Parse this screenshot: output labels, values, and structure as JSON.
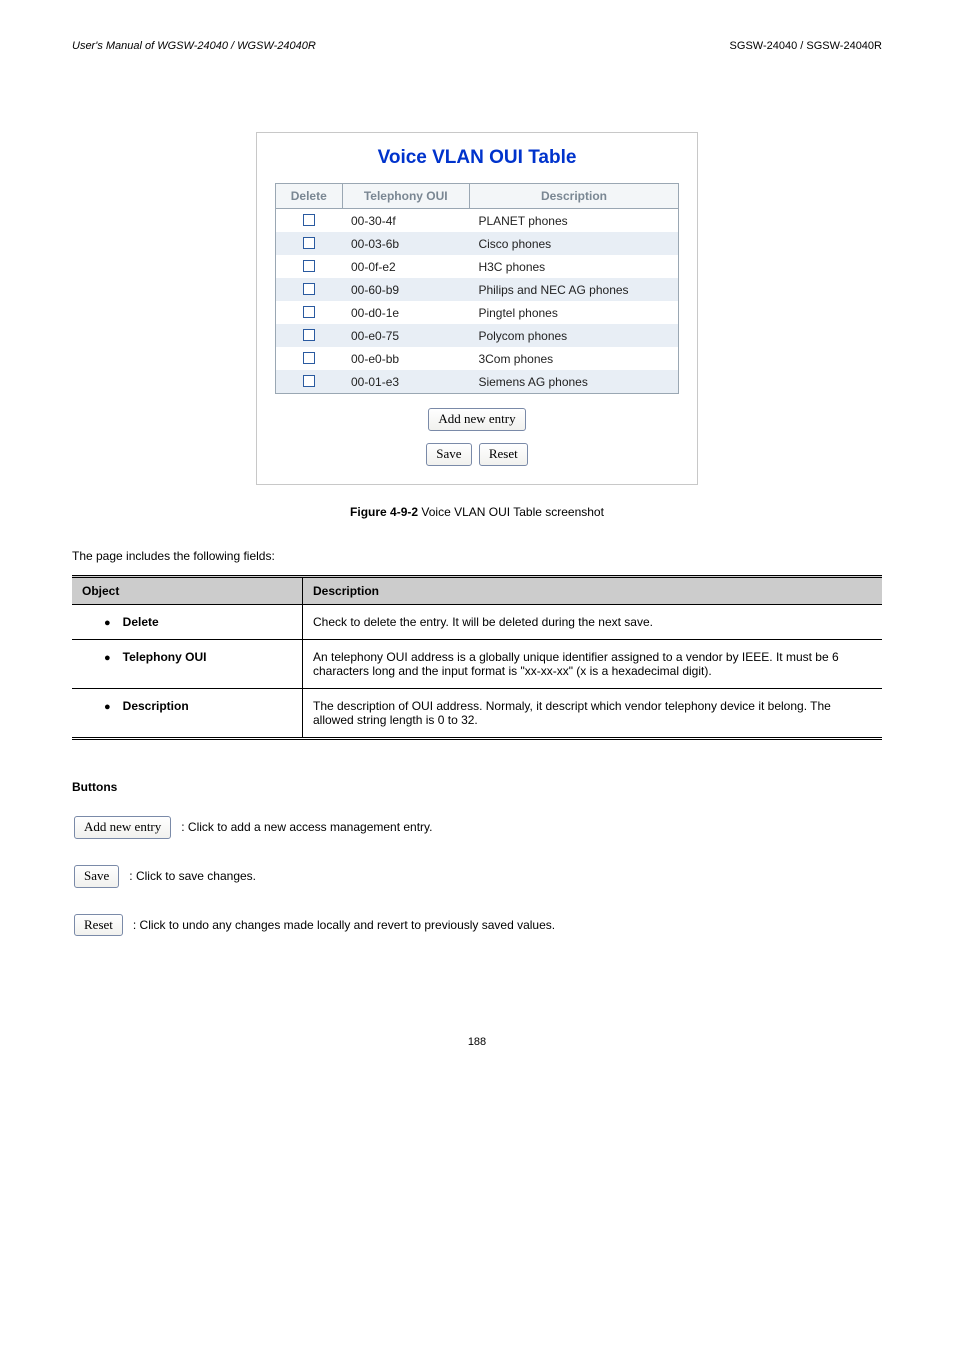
{
  "header": {
    "left": "User's Manual of WGSW-24040 / WGSW-24040R",
    "right": "SGSW-24040 / SGSW-24040R"
  },
  "figure": {
    "title": "Voice VLAN OUI Table",
    "columns": {
      "c0": "Delete",
      "c1": "Telephony OUI",
      "c2": "Description"
    },
    "rows": [
      {
        "oui": "00-30-4f",
        "desc": "PLANET phones"
      },
      {
        "oui": "00-03-6b",
        "desc": "Cisco phones"
      },
      {
        "oui": "00-0f-e2",
        "desc": "H3C phones"
      },
      {
        "oui": "00-60-b9",
        "desc": "Philips and NEC AG phones"
      },
      {
        "oui": "00-d0-1e",
        "desc": "Pingtel phones"
      },
      {
        "oui": "00-e0-75",
        "desc": "Polycom phones"
      },
      {
        "oui": "00-e0-bb",
        "desc": "3Com phones"
      },
      {
        "oui": "00-01-e3",
        "desc": "Siemens AG phones"
      }
    ],
    "buttons": {
      "add": "Add new entry",
      "save": "Save",
      "reset": "Reset"
    },
    "caption_strong": "Figure 4-9-2",
    "caption_rest": " Voice VLAN OUI Table screenshot"
  },
  "lead": "The page includes the following fields:",
  "desc": {
    "head_obj": "Object",
    "head_desc": "Description",
    "rows": [
      {
        "obj": "Delete",
        "text": "Check to delete the entry. It will be deleted during the next save."
      },
      {
        "obj": "Telephony OUI",
        "text": "An telephony OUI address is a globally unique identifier assigned to a vendor by IEEE. It must be 6 characters long and the input format is \"xx-xx-xx\" (x is a hexadecimal digit)."
      },
      {
        "obj": "Description",
        "text": "The description of OUI address. Normaly, it descript which vendor telephony device it belong. The allowed string length is 0 to 32."
      }
    ]
  },
  "buttons_section": {
    "title": "Buttons",
    "items": [
      {
        "label": "Add new entry",
        "text": ": Click to add a new access management entry."
      },
      {
        "label": "Save",
        "text": ": Click to save changes."
      },
      {
        "label": "Reset",
        "text": ": Click to undo any changes made locally and revert to previously saved values."
      }
    ]
  },
  "footer": "188"
}
